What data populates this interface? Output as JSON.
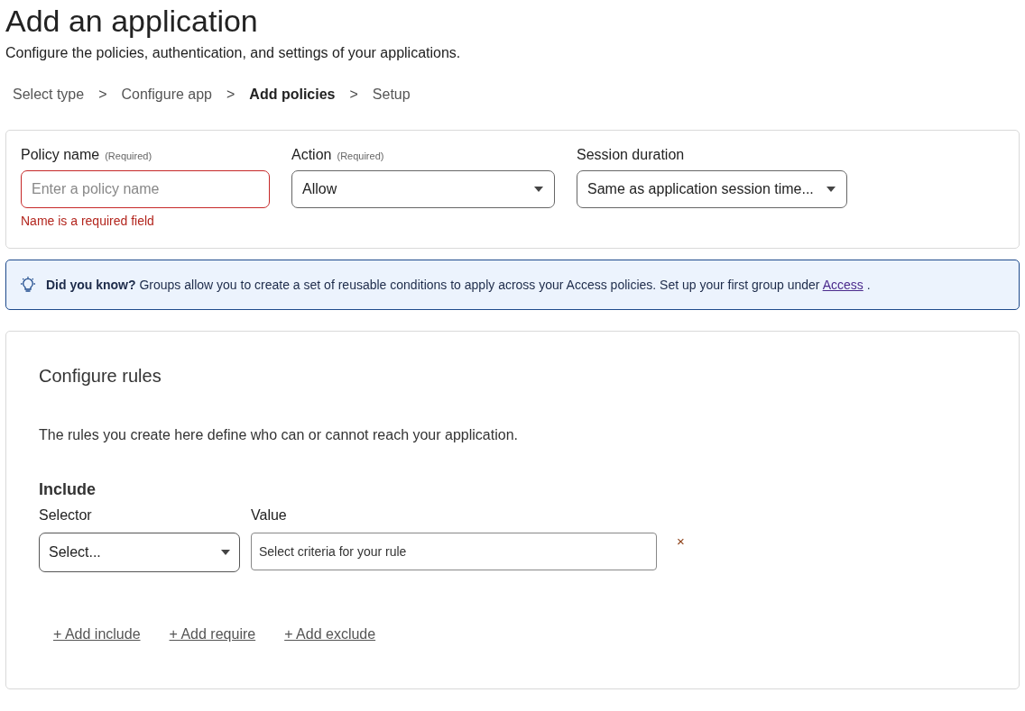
{
  "page": {
    "title": "Add an application",
    "subtitle": "Configure the policies, authentication, and settings of your applications."
  },
  "steps": [
    {
      "label": "Select type",
      "selected": false,
      "separator": ">"
    },
    {
      "label": "Configure app",
      "selected": false,
      "separator": ">"
    },
    {
      "label": "Add policies",
      "selected": true,
      "separator": ">"
    },
    {
      "label": "Setup",
      "selected": false
    }
  ],
  "policy": {
    "fields": [
      {
        "kind": "input",
        "label": "Policy name",
        "hint": "(Required)",
        "placeholder": "Enter a policy name",
        "error": "Name is a required field"
      },
      {
        "kind": "dropdown",
        "label": "Action",
        "hint": "(Required)",
        "value": "Allow"
      },
      {
        "kind": "dropdown",
        "label": "Session duration",
        "value": "Same as application session time..."
      }
    ]
  },
  "notice": {
    "text": "**Did you know?** Groups allow you to create a set of reusable conditions to apply across your Access policies. Set up your first group under",
    "link": "Access",
    "end": "."
  },
  "rules": {
    "title": "Configure rules",
    "description": "The rules you create here define who can or cannot reach your application.",
    "section": "Include",
    "selector_label": "Selector",
    "selector_value": "Select...",
    "value_label": "Value",
    "value_placeholder": "Select criteria for your rule",
    "remove": "×",
    "actions": [
      "+ Add include",
      "+ Add require",
      "+ Add exclude"
    ]
  }
}
